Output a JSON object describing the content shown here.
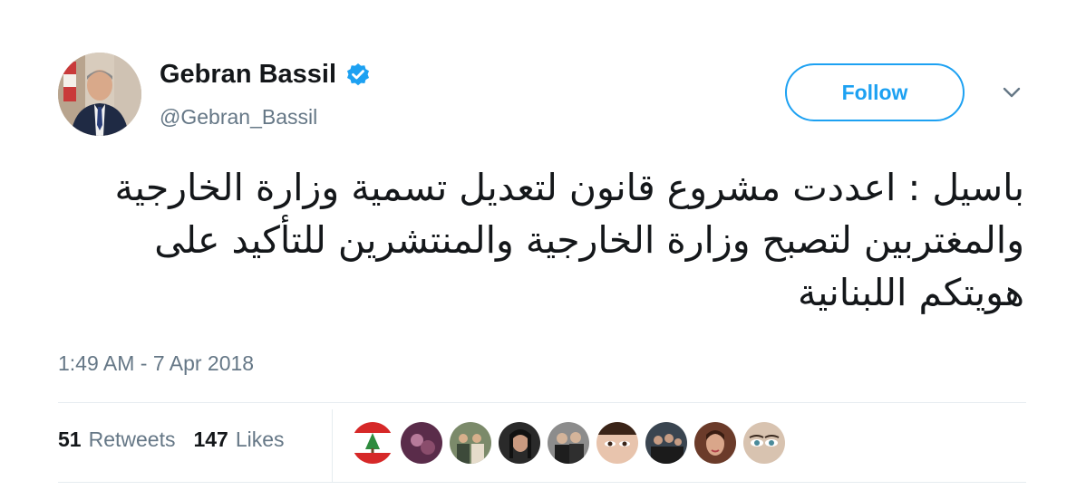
{
  "user": {
    "display_name": "Gebran Bassil",
    "handle": "@Gebran_Bassil",
    "verified": true
  },
  "follow_button": {
    "label": "Follow"
  },
  "tweet": {
    "text": "باسيل : اعددت مشروع قانون لتعديل تسمية وزارة الخارجية والمغتربين لتصبح وزارة الخارجية والمنتشرين للتأكيد على هويتكم اللبنانية",
    "timestamp": "1:49 AM - 7 Apr 2018"
  },
  "stats": {
    "retweets_count": "51",
    "retweets_label": "Retweets",
    "likes_count": "147",
    "likes_label": "Likes"
  },
  "colors": {
    "accent": "#1da1f2",
    "secondary_text": "#657786",
    "divider": "#e6ecf0"
  },
  "icons": {
    "verified": "verified-badge-icon",
    "menu": "chevron-down-icon"
  }
}
